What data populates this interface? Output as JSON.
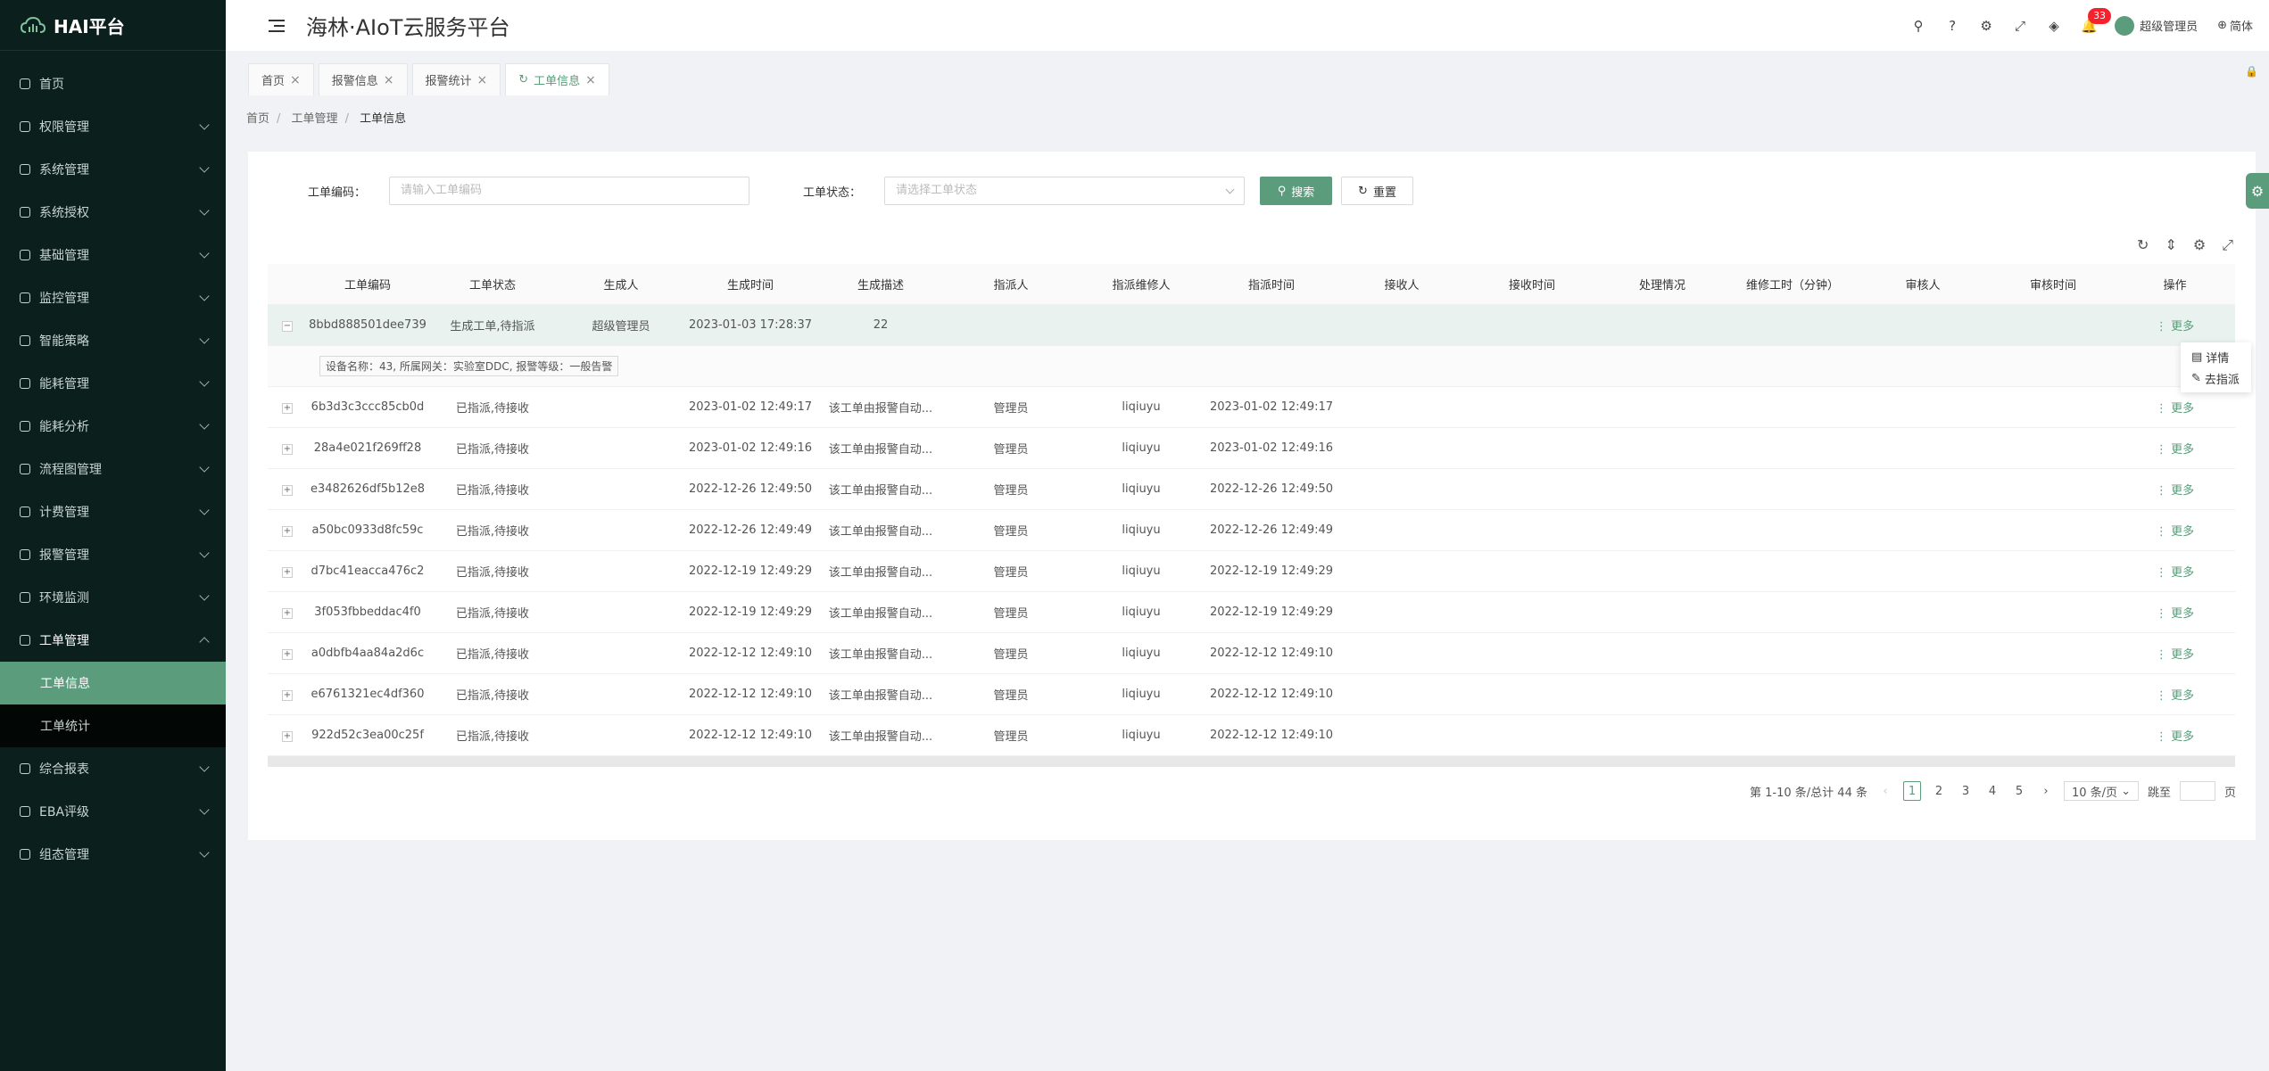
{
  "app": {
    "logo": "HAI平台",
    "title": "海林·AIoT云服务平台"
  },
  "header": {
    "notification_count": "33",
    "user_name": "超级管理员",
    "language": "简体"
  },
  "sidebar": {
    "items": [
      {
        "label": "首页",
        "chevron": false
      },
      {
        "label": "权限管理",
        "chevron": true
      },
      {
        "label": "系统管理",
        "chevron": true
      },
      {
        "label": "系统授权",
        "chevron": true
      },
      {
        "label": "基础管理",
        "chevron": true
      },
      {
        "label": "监控管理",
        "chevron": true
      },
      {
        "label": "智能策略",
        "chevron": true
      },
      {
        "label": "能耗管理",
        "chevron": true
      },
      {
        "label": "能耗分析",
        "chevron": true
      },
      {
        "label": "流程图管理",
        "chevron": true
      },
      {
        "label": "计费管理",
        "chevron": true
      },
      {
        "label": "报警管理",
        "chevron": true
      },
      {
        "label": "环境监测",
        "chevron": true
      },
      {
        "label": "工单管理",
        "chevron": true
      }
    ],
    "sub_items": [
      "工单信息",
      "工单统计"
    ],
    "after_items": [
      {
        "label": "综合报表"
      },
      {
        "label": "EBA评级"
      },
      {
        "label": "组态管理"
      }
    ]
  },
  "tabs": [
    {
      "label": "首页"
    },
    {
      "label": "报警信息"
    },
    {
      "label": "报警统计"
    },
    {
      "label": "工单信息"
    }
  ],
  "breadcrumb": [
    "首页",
    "工单管理",
    "工单信息"
  ],
  "search": {
    "code_label": "工单编码：",
    "code_placeholder": "请输入工单编码",
    "status_label": "工单状态：",
    "status_placeholder": "请选择工单状态",
    "search_btn": "搜索",
    "reset_btn": "重置"
  },
  "table": {
    "columns": [
      "工单编码",
      "工单状态",
      "生成人",
      "生成时间",
      "生成描述",
      "指派人",
      "指派维修人",
      "指派时间",
      "接收人",
      "接收时间",
      "处理情况",
      "维修工时（分钟）",
      "审核人",
      "审核时间",
      "操作"
    ],
    "more_label": "更多",
    "detail_text": "设备名称：43, 所属网关：实验室DDC, 报警等级：一般告警",
    "rows": [
      {
        "code": "8bbd888501dee739",
        "status": "生成工单,待指派",
        "creator": "超级管理员",
        "time": "2023-01-03 17:28:37",
        "desc": "22",
        "assigner": "",
        "repairer": "",
        "assign_time": ""
      },
      {
        "code": "6b3d3c3ccc85cb0d",
        "status": "已指派,待接收",
        "creator": "",
        "time": "2023-01-02 12:49:17",
        "desc": "该工单由报警自动...",
        "assigner": "管理员",
        "repairer": "liqiuyu",
        "assign_time": "2023-01-02 12:49:17"
      },
      {
        "code": "28a4e021f269ff28",
        "status": "已指派,待接收",
        "creator": "",
        "time": "2023-01-02 12:49:16",
        "desc": "该工单由报警自动...",
        "assigner": "管理员",
        "repairer": "liqiuyu",
        "assign_time": "2023-01-02 12:49:16"
      },
      {
        "code": "e3482626df5b12e8",
        "status": "已指派,待接收",
        "creator": "",
        "time": "2022-12-26 12:49:50",
        "desc": "该工单由报警自动...",
        "assigner": "管理员",
        "repairer": "liqiuyu",
        "assign_time": "2022-12-26 12:49:50"
      },
      {
        "code": "a50bc0933d8fc59c",
        "status": "已指派,待接收",
        "creator": "",
        "time": "2022-12-26 12:49:49",
        "desc": "该工单由报警自动...",
        "assigner": "管理员",
        "repairer": "liqiuyu",
        "assign_time": "2022-12-26 12:49:49"
      },
      {
        "code": "d7bc41eacca476c2",
        "status": "已指派,待接收",
        "creator": "",
        "time": "2022-12-19 12:49:29",
        "desc": "该工单由报警自动...",
        "assigner": "管理员",
        "repairer": "liqiuyu",
        "assign_time": "2022-12-19 12:49:29"
      },
      {
        "code": "3f053fbbeddac4f0",
        "status": "已指派,待接收",
        "creator": "",
        "time": "2022-12-19 12:49:29",
        "desc": "该工单由报警自动...",
        "assigner": "管理员",
        "repairer": "liqiuyu",
        "assign_time": "2022-12-19 12:49:29"
      },
      {
        "code": "a0dbfb4aa84a2d6c",
        "status": "已指派,待接收",
        "creator": "",
        "time": "2022-12-12 12:49:10",
        "desc": "该工单由报警自动...",
        "assigner": "管理员",
        "repairer": "liqiuyu",
        "assign_time": "2022-12-12 12:49:10"
      },
      {
        "code": "e6761321ec4df360",
        "status": "已指派,待接收",
        "creator": "",
        "time": "2022-12-12 12:49:10",
        "desc": "该工单由报警自动...",
        "assigner": "管理员",
        "repairer": "liqiuyu",
        "assign_time": "2022-12-12 12:49:10"
      },
      {
        "code": "922d52c3ea00c25f",
        "status": "已指派,待接收",
        "creator": "",
        "time": "2022-12-12 12:49:10",
        "desc": "该工单由报警自动...",
        "assigner": "管理员",
        "repairer": "liqiuyu",
        "assign_time": "2022-12-12 12:49:10"
      }
    ]
  },
  "dropdown": {
    "detail": "详情",
    "assign": "去指派"
  },
  "pagination": {
    "summary": "第 1-10 条/总计 44 条",
    "pages": [
      "1",
      "2",
      "3",
      "4",
      "5"
    ],
    "current": "1",
    "page_size": "10 条/页",
    "jump_label": "跳至",
    "page_suffix": "页"
  },
  "colors": {
    "accent": "#5a9c7b",
    "sidebar_bg": "#0b1f1c",
    "badge": "#f5222d"
  }
}
